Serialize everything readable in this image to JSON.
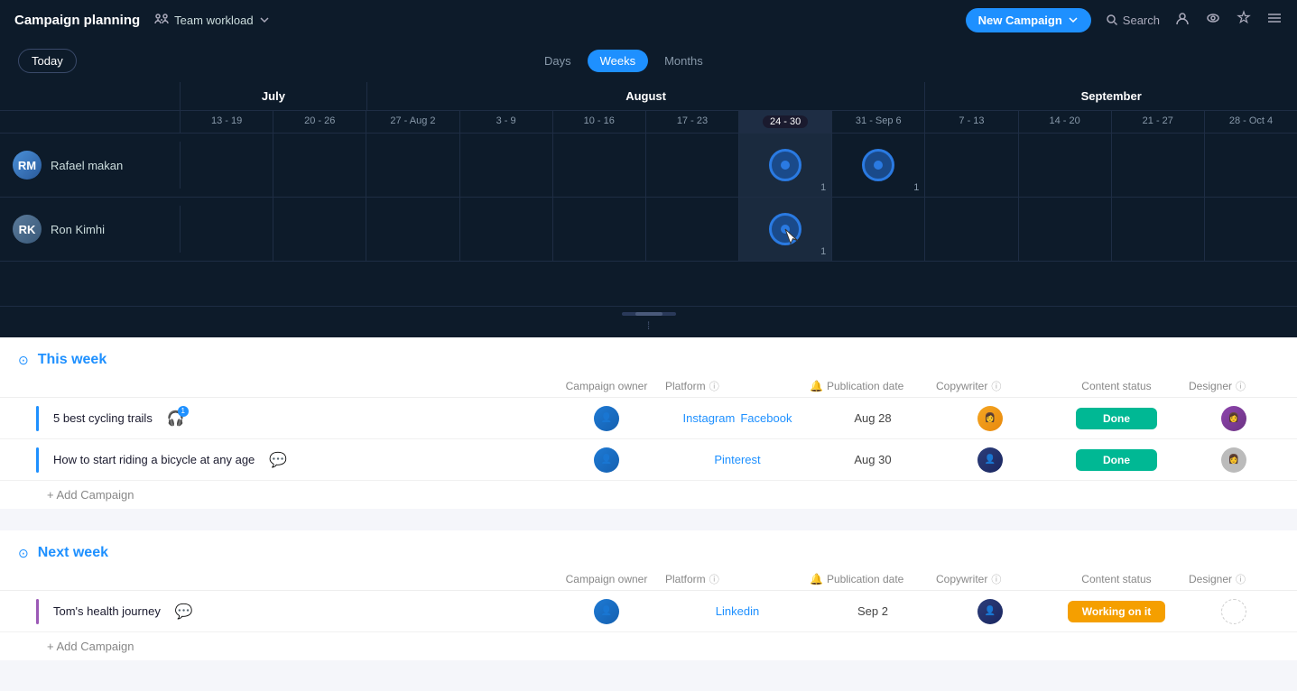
{
  "topNav": {
    "title": "Campaign planning",
    "teamWorkload": "Team workload",
    "newCampaign": "New Campaign",
    "search": "Search"
  },
  "viewControls": {
    "today": "Today",
    "days": "Days",
    "weeks": "Weeks",
    "months": "Months"
  },
  "calendar": {
    "months": [
      {
        "label": "July",
        "span": 2
      },
      {
        "label": "August",
        "span": 6
      },
      {
        "label": "September",
        "span": 4
      }
    ],
    "weeks": [
      "13 - 19",
      "20 - 26",
      "27 - Aug 2",
      "3 - 9",
      "10 - 16",
      "17 - 23",
      "24 - 30",
      "31 - Sep 6",
      "7 - 13",
      "14 - 20",
      "21 - 27",
      "28 - Oct 4"
    ],
    "activeWeek": "24 - 30",
    "persons": [
      {
        "name": "Rafael makan",
        "avatarInitials": "RM",
        "dotsAt": [
          6,
          7
        ],
        "counts": [
          1,
          1
        ]
      },
      {
        "name": "Ron Kimhi",
        "avatarInitials": "RK",
        "dotsAt": [
          6
        ],
        "counts": [
          1
        ]
      }
    ]
  },
  "thisWeek": {
    "sectionTitle": "This week",
    "columns": {
      "campaignOwner": "Campaign owner",
      "platform": "Platform",
      "publicationDate": "Publication date",
      "copywriter": "Copywriter",
      "contentStatus": "Content status",
      "designer": "Designer"
    },
    "campaigns": [
      {
        "name": "5 best cycling trails",
        "hasNotification": true,
        "notifCount": "1",
        "platforms": [
          "Instagram",
          "Facebook"
        ],
        "pubDate": "Aug 28",
        "status": "Done",
        "statusType": "done"
      },
      {
        "name": "How to start riding a bicycle at any age",
        "hasNotification": false,
        "platforms": [
          "Pinterest"
        ],
        "pubDate": "Aug 30",
        "status": "Done",
        "statusType": "done"
      }
    ],
    "addLabel": "+ Add Campaign"
  },
  "nextWeek": {
    "sectionTitle": "Next week",
    "columns": {
      "campaignOwner": "Campaign owner",
      "platform": "Platform",
      "publicationDate": "Publication date",
      "copywriter": "Copywriter",
      "contentStatus": "Content status",
      "designer": "Designer"
    },
    "campaigns": [
      {
        "name": "Tom's health journey",
        "hasNotification": false,
        "platforms": [
          "Linkedin"
        ],
        "pubDate": "Sep 2",
        "status": "Working on it",
        "statusType": "working"
      }
    ],
    "addLabel": "+ Add Campaign"
  }
}
